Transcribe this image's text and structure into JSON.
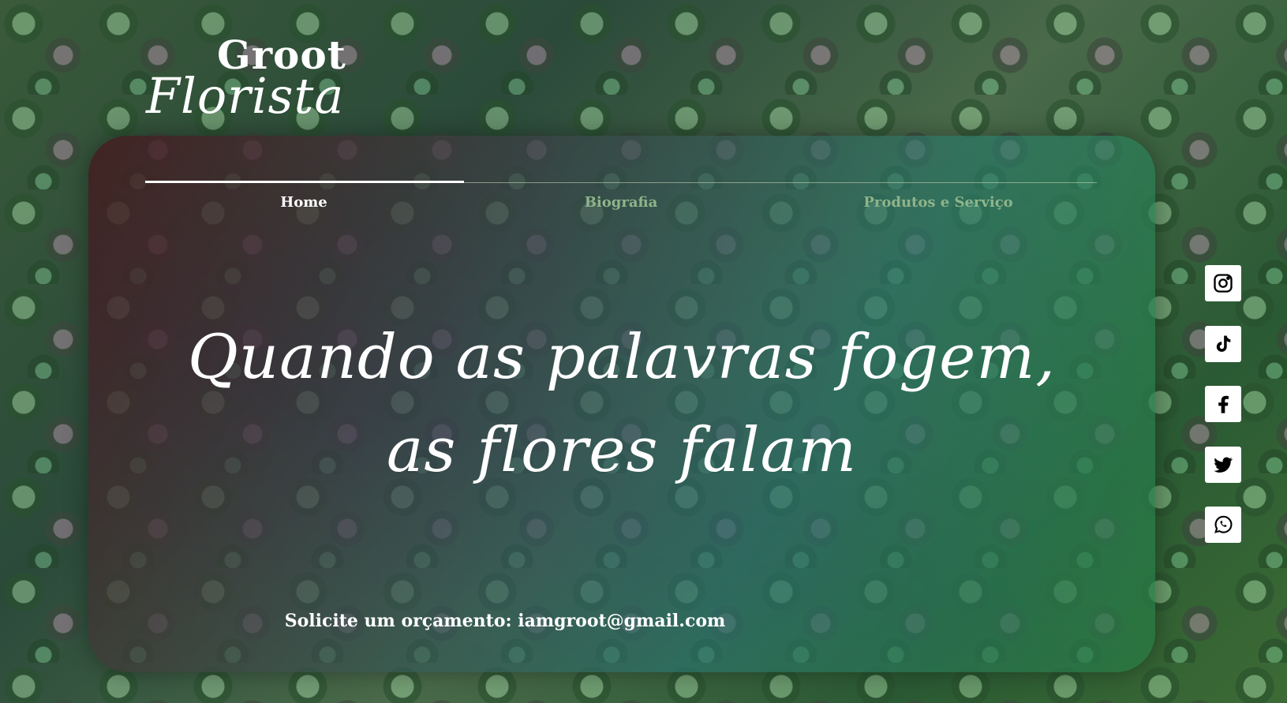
{
  "logo": {
    "line1": "Groot",
    "line2": "Florista"
  },
  "nav": {
    "items": [
      {
        "label": "Home",
        "active": true
      },
      {
        "label": "Biografia",
        "active": false
      },
      {
        "label": "Produtos e Serviço",
        "active": false
      }
    ]
  },
  "hero": {
    "line1": "Quando as palavras fogem,",
    "line2": "as flores falam"
  },
  "cta": {
    "text": "Solicite um orçamento: iamgroot@gmail.com"
  },
  "social": [
    "instagram-icon",
    "tiktok-icon",
    "facebook-icon",
    "twitter-icon",
    "whatsapp-icon"
  ],
  "colors": {
    "accent": "#ffffff",
    "nav_inactive": "#8fb48a"
  }
}
